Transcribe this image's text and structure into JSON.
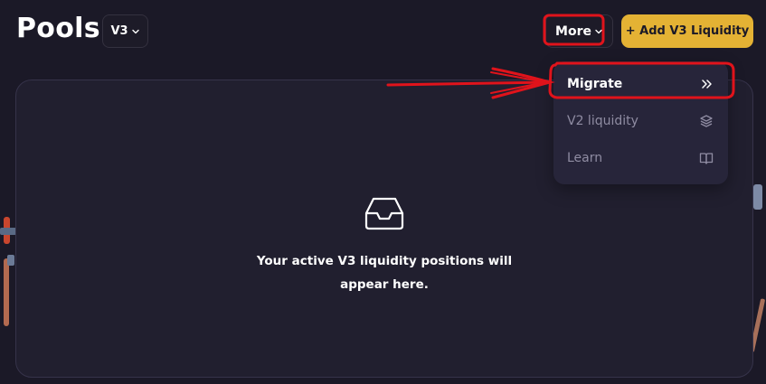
{
  "header": {
    "title": "Pools",
    "version_label": "V3",
    "more_label": "More",
    "add_label": "+ Add V3 Liquidity"
  },
  "menu": {
    "items": [
      {
        "label": "Migrate",
        "icon": "double-chevron-right-icon"
      },
      {
        "label": "V2 liquidity",
        "icon": "layers-icon"
      },
      {
        "label": "Learn",
        "icon": "book-icon"
      }
    ]
  },
  "empty_state": {
    "icon": "inbox-icon",
    "message": "Your active V3 liquidity positions will appear here."
  },
  "colors": {
    "background": "#1b1927",
    "panel": "#211f2f",
    "accent": "#e4b234",
    "annotation": "#e0131b"
  }
}
